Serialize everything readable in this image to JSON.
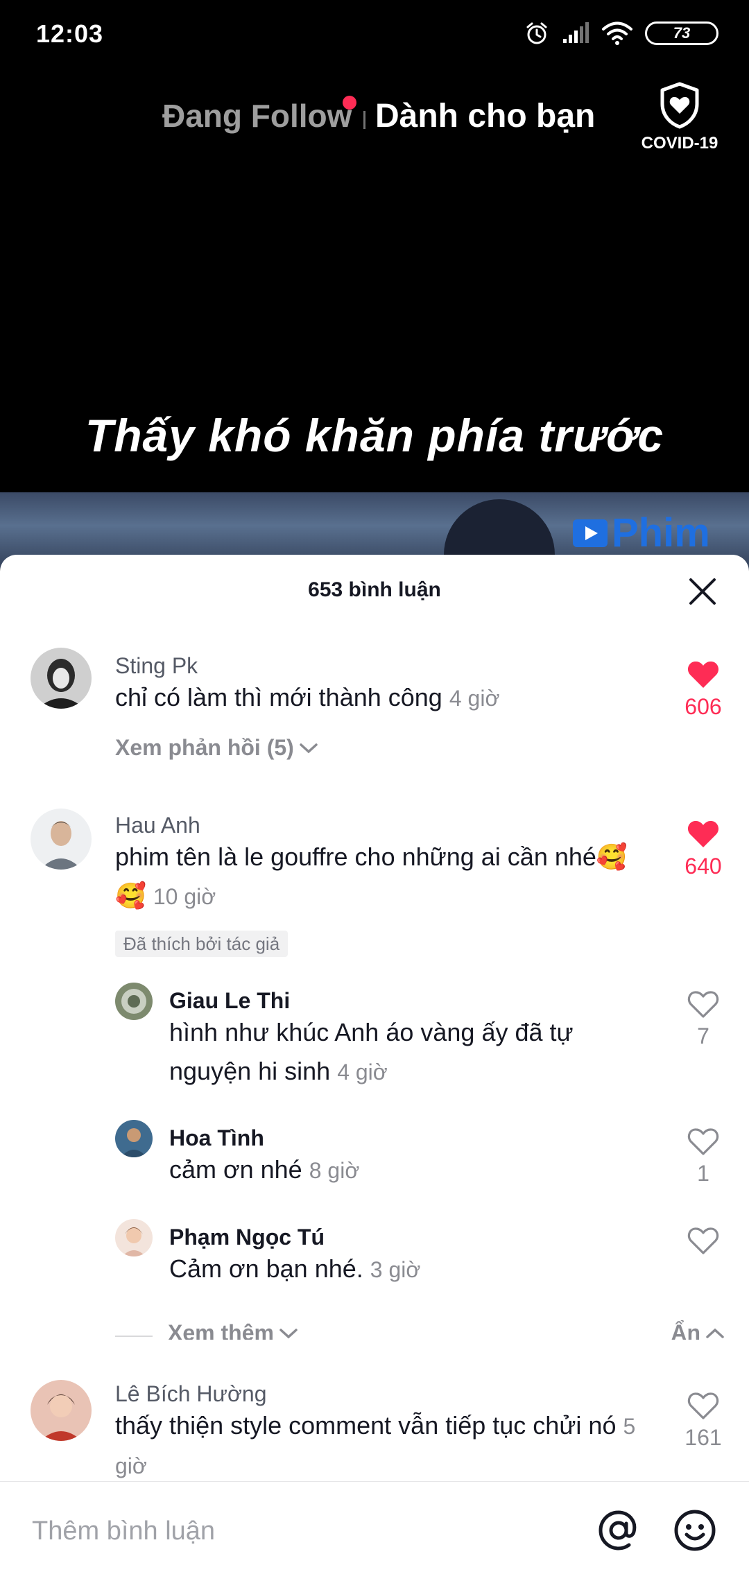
{
  "status": {
    "time": "12:03",
    "battery": "73"
  },
  "nav": {
    "following": "Đang Follow",
    "for_you": "Dành cho bạn",
    "covid_label": "COVID-19"
  },
  "video": {
    "caption": "Thấy khó khăn phía trước",
    "watermark": "Phim"
  },
  "comments_sheet": {
    "title": "653 bình luận",
    "comments": [
      {
        "user": "Sting Pk",
        "text": "chỉ có làm thì mới thành công",
        "time": "4 giờ",
        "likes": "606",
        "liked": true,
        "view_replies": "Xem phản hồi (5)"
      },
      {
        "user": "Hau Anh",
        "text": "phim tên là le gouffre cho những ai cần nhé🥰🥰",
        "time": "10 giờ",
        "likes": "640",
        "liked": true,
        "creator_badge": "Đã thích bởi tác giả",
        "replies": [
          {
            "user": "Giau Le Thi",
            "text": "hình như khúc Anh áo vàng ấy đã tự nguyện hi sinh",
            "time": "4 giờ",
            "likes": "7"
          },
          {
            "user": "Hoa Tình",
            "text": "cảm ơn nhé",
            "time": "8 giờ",
            "likes": "1"
          },
          {
            "user": "Phạm Ngọc Tú",
            "text": "Cảm ơn bạn nhé.",
            "time": "3 giờ",
            "likes": ""
          }
        ],
        "see_more": "Xem thêm",
        "hide": "Ẩn"
      },
      {
        "user": "Lê Bích Hường",
        "text": "thấy thiện style comment vẫn tiếp tục chửi nó",
        "time": "5 giờ",
        "likes": "161",
        "liked": false
      }
    ]
  },
  "input": {
    "placeholder": "Thêm bình luận"
  },
  "colors": {
    "accent": "#fe2c55",
    "text": "#161823",
    "muted": "#8a8b91"
  }
}
